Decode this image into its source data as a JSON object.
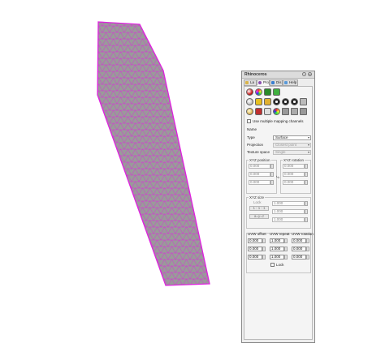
{
  "panel": {
    "title": "Rhinoceros",
    "tabs": [
      {
        "label": "La",
        "color": "#d9b44a"
      },
      {
        "label": "Pro",
        "color": "#8a4fb0"
      },
      {
        "label": "Dis",
        "color": "#3a7fd0"
      },
      {
        "label": "Help",
        "color": "#5a9ad8"
      }
    ],
    "use_multiple_label": "Use multiple mapping channels",
    "name_label": "Name",
    "type_label": "Type",
    "type_value": "Surface",
    "projection_label": "Projection",
    "projection_value": "Closest point",
    "texture_space_label": "Texture space",
    "texture_space_value": "Single",
    "xyz_position_label": "XYZ position",
    "xyz_rotation_label": "XYZ rotation",
    "xyz_size_label": "XYZ size",
    "lock_label": "Lock",
    "btn_111": "1 : 1 : 1",
    "btn_xyz": "a=y=z",
    "uvw_offset_label": "UVW offset",
    "uvw_repeat_label": "UVW repeat",
    "uvw_rotation_label": "UVW rotation",
    "uvw_lock_label": "Lock",
    "val_zero": "0.000",
    "val_one": "1.000"
  },
  "colors": {
    "mesh_fill": "#9a9a9a",
    "mesh_edge": "#e020e0"
  }
}
